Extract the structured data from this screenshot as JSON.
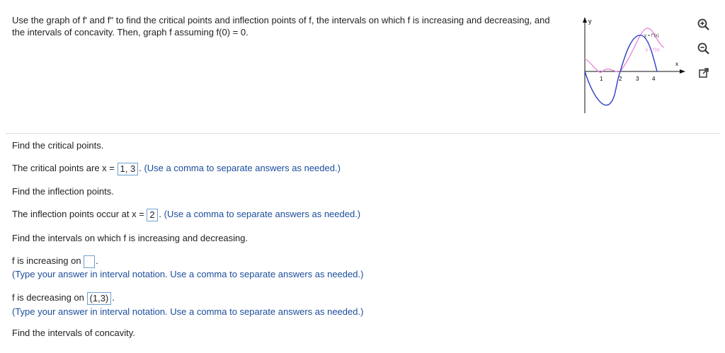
{
  "problem": {
    "line1": "Use the graph of f′ and f′′ to find the critical points and inflection points of f, the intervals on which f is increasing and decreasing, and",
    "line2": "the intervals of concavity. Then, graph f assuming f(0) = 0."
  },
  "graph": {
    "y_axis_label": "y",
    "x_axis_label": "x",
    "legend_fpp": "y = f′′(x)",
    "legend_fp": "y = f′(x)",
    "ticks": [
      "1",
      "2",
      "3",
      "4"
    ],
    "fp_color": "#2b3fc4",
    "fpp_color": "#e67ad8"
  },
  "tools": {
    "zoom_in": "zoom-in-icon",
    "zoom_out": "zoom-out-icon",
    "popout": "popout-icon"
  },
  "q1": {
    "prompt": "Find the critical points."
  },
  "q2": {
    "prefix": "The critical points are x =",
    "answer": "1, 3",
    "hint": "(Use a comma to separate answers as needed.)"
  },
  "q3": {
    "prompt": "Find the inflection points."
  },
  "q4": {
    "prefix": "The inflection points occur at x =",
    "answer": "2",
    "hint": "(Use a comma to separate answers as needed.)"
  },
  "q5": {
    "prompt": "Find the intervals on which f is increasing and decreasing."
  },
  "q6": {
    "prefix": "f is increasing on",
    "answer": "",
    "hint": "(Type your answer in interval notation. Use a comma to separate answers as needed.)"
  },
  "q7": {
    "prefix": "f is decreasing on",
    "answer": "(1,3)",
    "hint": "(Type your answer in interval notation. Use a comma to separate answers as needed.)"
  },
  "q8": {
    "prompt": "Find the intervals of concavity."
  }
}
